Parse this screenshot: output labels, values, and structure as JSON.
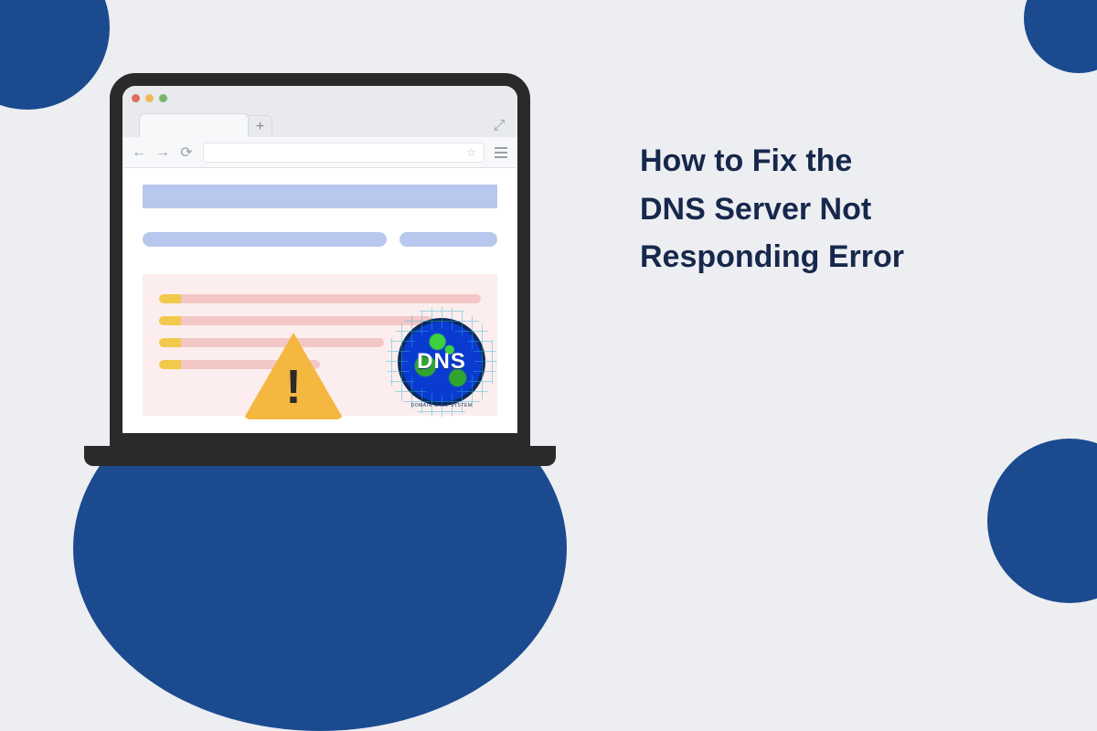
{
  "headline": {
    "line1": "How to Fix the",
    "line2": "DNS Server Not",
    "line3": "Responding Error"
  },
  "dns_badge": {
    "label": "DNS",
    "sublabel": "DOMAIN NAME SYSTEM"
  },
  "colors": {
    "bg": "#eceef2",
    "brand": "#1b4a8f",
    "headline": "#17284c",
    "placeholder_blue": "#b8c7ed",
    "error_bg": "#fceeee",
    "warning": "#f4b740"
  },
  "icons": {
    "back": "←",
    "forward": "→",
    "reload": "⟳",
    "star": "☆",
    "plus": "+",
    "resize": "⤢",
    "bang": "!"
  }
}
